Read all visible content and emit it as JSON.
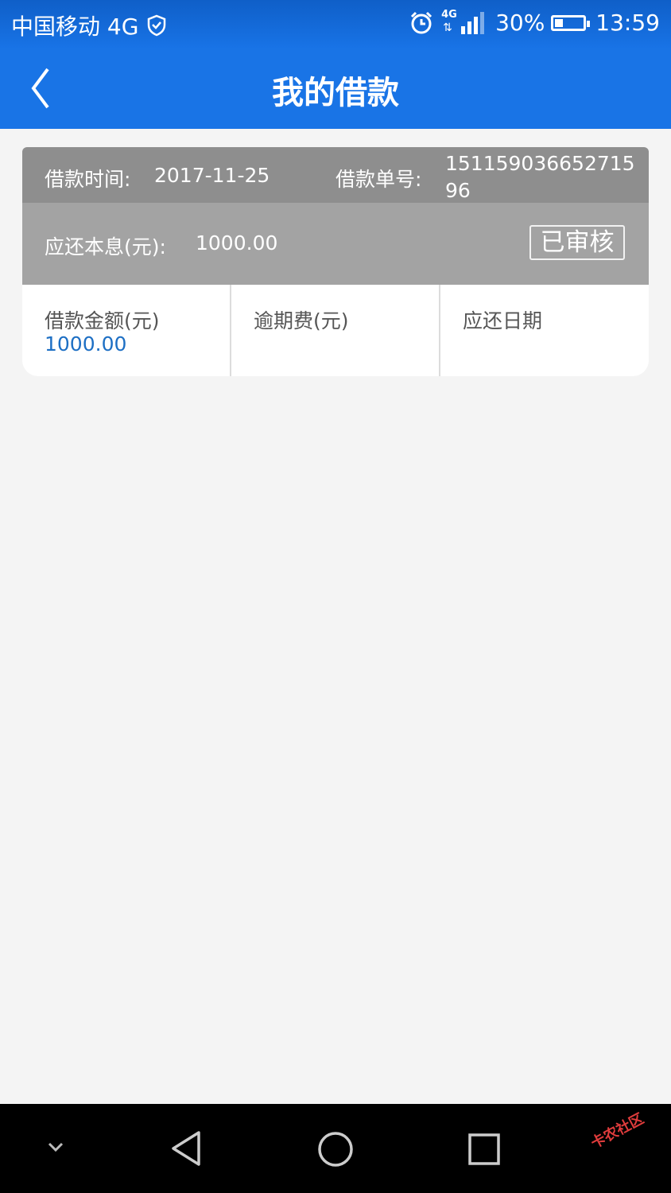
{
  "status_bar": {
    "carrier": "中国移动 4G",
    "network_badge": "4G",
    "battery": "30%",
    "battery_level": 0.3,
    "time": "13:59",
    "icons": [
      "shield-check-icon",
      "alarm-icon",
      "signal-icon",
      "battery-icon"
    ]
  },
  "header": {
    "title": "我的借款",
    "back_icon": "chevron-left-icon",
    "color": "#1974e6"
  },
  "loan_card": {
    "date_label": "借款时间:",
    "date_value": "2017-11-25",
    "id_label": "借款单号:",
    "id_value": "15115903665271596",
    "due_label": "应还本息(元):",
    "due_value": "1000.00",
    "status_badge": "已审核",
    "columns": [
      {
        "label": "借款金额(元)",
        "value": "1000.00"
      },
      {
        "label": "逾期费(元)",
        "value": ""
      },
      {
        "label": "应还日期",
        "value": ""
      }
    ]
  },
  "nav_bar": {
    "buttons": [
      "chevron-down-icon",
      "back-triangle-icon",
      "home-circle-icon",
      "recents-square-icon"
    ]
  },
  "watermark": {
    "text": "卡农社区"
  }
}
